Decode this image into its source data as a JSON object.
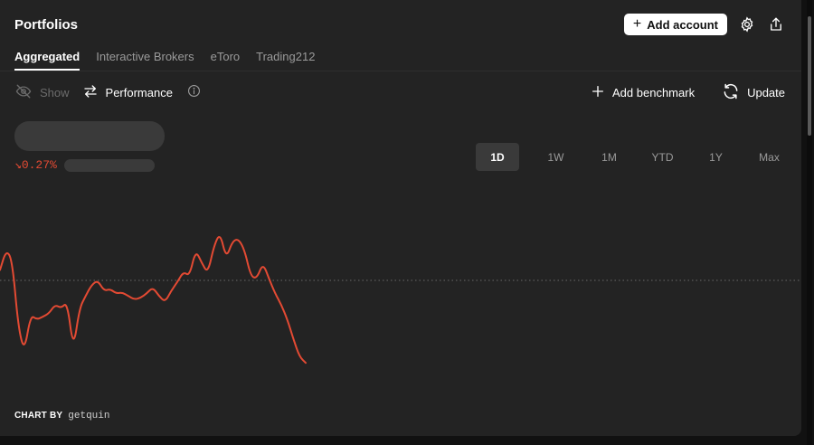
{
  "header": {
    "title": "Portfolios",
    "add_account_label": "Add account",
    "settings_icon": "gear-icon",
    "share_icon": "share-icon"
  },
  "tabs": [
    {
      "label": "Aggregated",
      "active": true
    },
    {
      "label": "Interactive Brokers",
      "active": false
    },
    {
      "label": "eToro",
      "active": false
    },
    {
      "label": "Trading212",
      "active": false
    }
  ],
  "toolbar": {
    "show_label": "Show",
    "performance_label": "Performance",
    "add_benchmark_label": "Add benchmark",
    "update_label": "Update"
  },
  "summary": {
    "change_text": "↘0.27%"
  },
  "ranges": [
    {
      "label": "1D",
      "active": true
    },
    {
      "label": "1W",
      "active": false
    },
    {
      "label": "1M",
      "active": false
    },
    {
      "label": "YTD",
      "active": false
    },
    {
      "label": "1Y",
      "active": false
    },
    {
      "label": "Max",
      "active": false
    }
  ],
  "chart_data": {
    "type": "line",
    "line_color": "#e34a33",
    "baseline_style": "dotted",
    "series": [
      {
        "values": [
          0.12,
          0.35,
          0.24,
          -0.55,
          -0.82,
          -0.4,
          -0.45,
          -0.42,
          -0.38,
          -0.28,
          -0.32,
          -0.25,
          -0.8,
          -0.32,
          -0.18,
          -0.05,
          0.0,
          -0.12,
          -0.1,
          -0.15,
          -0.14,
          -0.18,
          -0.22,
          -0.2,
          -0.15,
          -0.08,
          -0.18,
          -0.25,
          -0.12,
          -0.02,
          0.1,
          0.05,
          0.35,
          0.2,
          0.08,
          0.4,
          0.55,
          0.25,
          0.45,
          0.48,
          0.35,
          0.05,
          0.02,
          0.2,
          0.02,
          -0.15,
          -0.28,
          -0.45,
          -0.68,
          -0.88,
          -0.95
        ]
      }
    ]
  },
  "footer": {
    "credit_label": "CHART BY",
    "credit_brand": "getquin"
  }
}
